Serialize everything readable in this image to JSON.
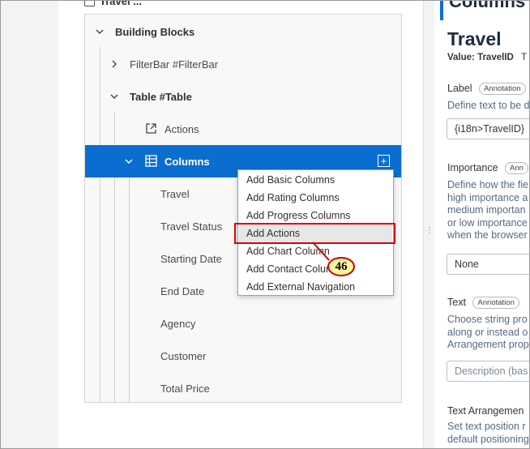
{
  "tree": {
    "top_cut_label": "Travel ...",
    "building_blocks": "Building Blocks",
    "filterbar": "FilterBar #FilterBar",
    "table": "Table #Table",
    "actions": "Actions",
    "columns": "Columns",
    "column_items": [
      "Travel",
      "Travel Status",
      "Starting Date",
      "End Date",
      "Agency",
      "Customer",
      "Total Price"
    ]
  },
  "context_menu": {
    "items": [
      "Add Basic Columns",
      "Add Rating Columns",
      "Add Progress Columns",
      "Add Actions",
      "Add Chart Column",
      "Add Contact Column",
      "Add External Navigation"
    ],
    "highlighted": "Add Actions"
  },
  "callout": {
    "number": "46"
  },
  "properties": {
    "header_cut": "Columns",
    "title": "Travel",
    "value_label": "Value: TravelID",
    "value_suffix": "T",
    "label_field": {
      "label": "Label",
      "badge": "Annotation",
      "desc": "Define text to be d",
      "value": "{i18n>TravelID}"
    },
    "importance_field": {
      "label": "Importance",
      "badge": "Ann",
      "desc_lines": [
        "Define how the fie",
        "high importance a",
        "medium importan",
        "or low importance",
        "when the browser"
      ],
      "value": "None"
    },
    "text_field": {
      "label": "Text",
      "badge": "Annotation",
      "desc_lines": [
        "Choose string pro",
        "along or instead o",
        "Arrangement prop"
      ],
      "placeholder": "Description (bas"
    },
    "text_arrangement_field": {
      "label": "Text Arrangemen",
      "desc_lines": [
        "Set text position r",
        "default positioning"
      ]
    }
  },
  "colors": {
    "selection": "#0a6ed1",
    "highlight_box": "#e00000",
    "callout_fill": "#fbf6a0"
  }
}
